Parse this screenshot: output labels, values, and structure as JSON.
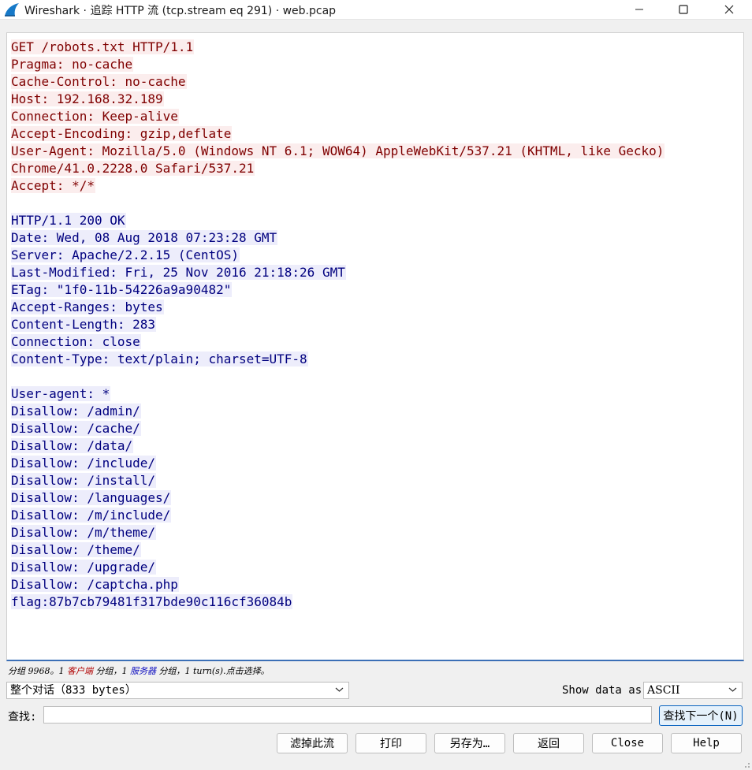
{
  "window": {
    "title": "Wireshark · 追踪 HTTP 流 (tcp.stream eq 291) · web.pcap",
    "app_icon": "wireshark-fin-icon",
    "controls": [
      "minimize-icon",
      "maximize-icon",
      "close-icon"
    ]
  },
  "colors": {
    "client_fg": "#7f0000",
    "client_bg": "#fbeded",
    "server_fg": "#00007f",
    "server_bg": "#ededfb",
    "accent": "#3b6fb6"
  },
  "stream": {
    "request_lines": [
      "GET /robots.txt HTTP/1.1",
      "Pragma: no-cache",
      "Cache-Control: no-cache",
      "Host: 192.168.32.189",
      "Connection: Keep-alive",
      "Accept-Encoding: gzip,deflate",
      "User-Agent: Mozilla/5.0 (Windows NT 6.1; WOW64) AppleWebKit/537.21 (KHTML, like Gecko)",
      "Chrome/41.0.2228.0 Safari/537.21",
      "Accept: */*"
    ],
    "response_header_lines": [
      "HTTP/1.1 200 OK",
      "Date: Wed, 08 Aug 2018 07:23:28 GMT",
      "Server: Apache/2.2.15 (CentOS)",
      "Last-Modified: Fri, 25 Nov 2016 21:18:26 GMT",
      "ETag: \"1f0-11b-54226a9a90482\"",
      "Accept-Ranges: bytes",
      "Content-Length: 283",
      "Connection: close",
      "Content-Type: text/plain; charset=UTF-8"
    ],
    "response_body_lines": [
      "User-agent: *",
      "Disallow: /admin/",
      "Disallow: /cache/",
      "Disallow: /data/",
      "Disallow: /include/",
      "Disallow: /install/",
      "Disallow: /languages/",
      "Disallow: /m/include/",
      "Disallow: /m/theme/",
      "Disallow: /theme/",
      "Disallow: /upgrade/",
      "Disallow: /captcha.php",
      "flag:87b7cb79481f317bde90c116cf36084b"
    ]
  },
  "status": {
    "prefix": "分组 9968。1 ",
    "client_word": "客户端",
    "middle": " 分组，1 ",
    "server_word": "服务器",
    "suffix": " 分组，1 turn(s).点击选择。"
  },
  "controls": {
    "conversation_select": "整个对话（833 bytes）",
    "show_data_label": "Show data as",
    "show_data_value": "ASCII",
    "find_label": "查找:",
    "find_value": "",
    "find_next_label": "查找下一个(N)"
  },
  "buttons": {
    "filter_out": "滤掉此流",
    "print": "打印",
    "save_as": "另存为…",
    "back": "返回",
    "close": "Close",
    "help": "Help"
  }
}
